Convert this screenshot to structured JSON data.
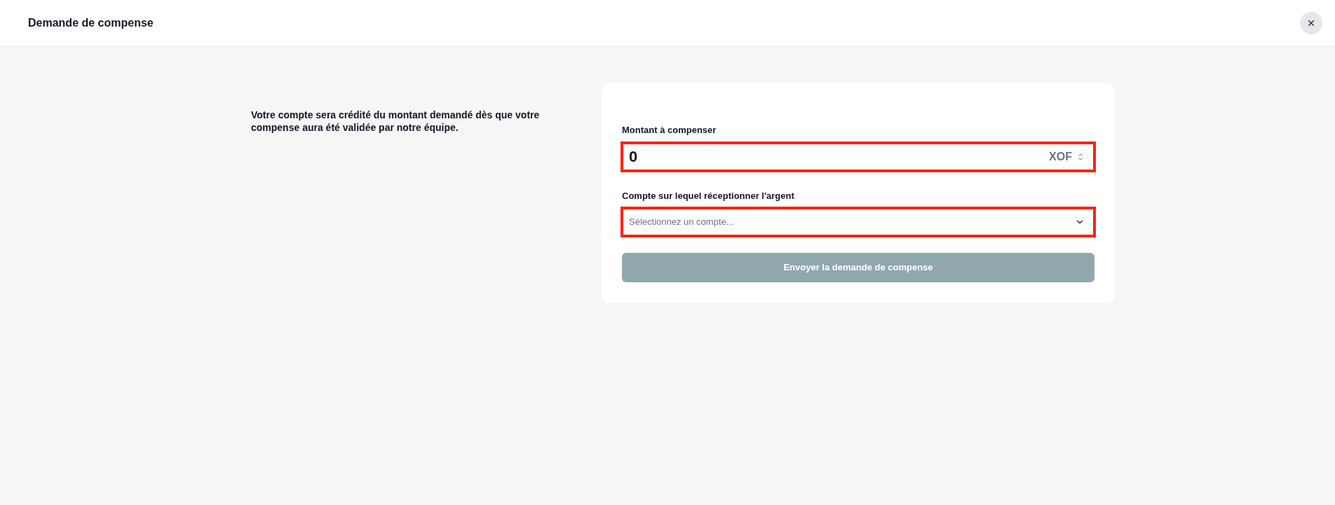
{
  "header": {
    "title": "Demande de compense"
  },
  "intro": "Votre compte sera crédité du montant demandé dès que votre compense aura été validée par notre équipe.",
  "form": {
    "fields": [
      {
        "kind": "amount",
        "label": "Montant à compenser",
        "value": "0",
        "currency": "XOF",
        "highlighted": true
      },
      {
        "kind": "select",
        "label": "Compte sur lequel réceptionner l'argent",
        "placeholder": "Sélectionnez un compte...",
        "highlighted": true
      }
    ],
    "submit": {
      "label": "Envoyer la demande de compense",
      "disabled": true
    }
  }
}
